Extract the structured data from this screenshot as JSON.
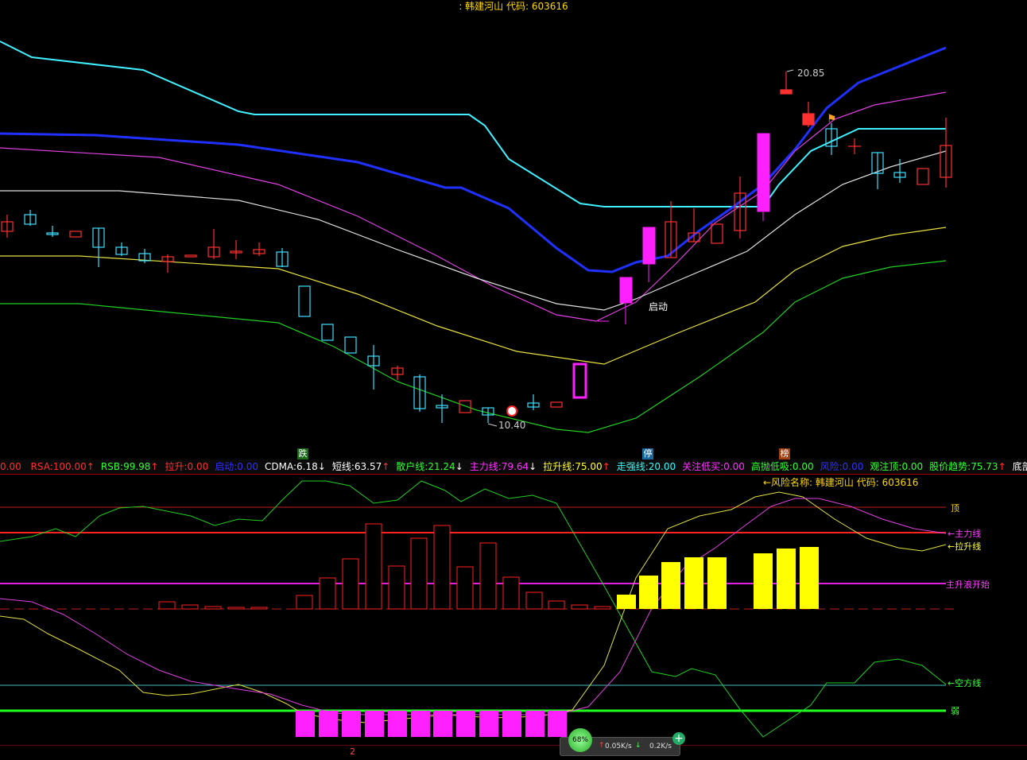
{
  "header": {
    "title": ": 韩建河山  代码: 603616"
  },
  "annotations": {
    "high_price": "20.85",
    "low_price": "10.40",
    "start_label": "启动"
  },
  "markers": {
    "die": "跌",
    "ting": "停",
    "bang": "榜"
  },
  "indicators": [
    {
      "label": "RSA:",
      "value": "100.00",
      "arrow": "↑",
      "color": "#ff3030"
    },
    {
      "label": "RSB:",
      "value": "99.98",
      "arrow": "↑",
      "color": "#30ff30"
    },
    {
      "label": "拉升:",
      "value": "0.00",
      "arrow": "",
      "color": "#ff3030"
    },
    {
      "label": "启动:",
      "value": "0.00",
      "arrow": "",
      "color": "#3030ff"
    },
    {
      "label": "CDMA:",
      "value": "6.18",
      "arrow": "↓",
      "color": "#ffffff"
    },
    {
      "label": "短线:",
      "value": "63.57",
      "arrow": "↑",
      "color": "#ffffff"
    },
    {
      "label": "散户线:",
      "value": "21.24",
      "arrow": "↓",
      "color": "#30ff30"
    },
    {
      "label": "主力线:",
      "value": "79.64",
      "arrow": "↓",
      "color": "#ff30ff"
    },
    {
      "label": "拉升线:",
      "value": "75.00",
      "arrow": "↑",
      "color": "#ffff30"
    },
    {
      "label": "走强线:",
      "value": "20.00",
      "arrow": "",
      "color": "#30ffff"
    },
    {
      "label": "关注低买:",
      "value": "0.00",
      "arrow": "",
      "color": "#ff30ff"
    },
    {
      "label": "高抛低吸:",
      "value": "0.00",
      "arrow": "",
      "color": "#30ff30"
    },
    {
      "label": "风险:",
      "value": "0.00",
      "arrow": "",
      "color": "#3030ff"
    },
    {
      "label": "观注顶:",
      "value": "0.00",
      "arrow": "",
      "color": "#30ff30"
    },
    {
      "label": "股价趋势:",
      "value": "75.73",
      "arrow": "↑",
      "color": "#30ff30"
    },
    {
      "label": "底部警戒",
      "value": "",
      "arrow": "",
      "color": "#ffffff"
    }
  ],
  "indicator_prefix": "0.00",
  "sub_panel": {
    "title": "←风险名称: 韩建河山  代码: 603616",
    "labels": {
      "top": "顶",
      "main_line": "←主力线",
      "lift_line": "←拉升线",
      "rise_start": "主升浪开始",
      "short_line": "←空方线",
      "weak": "弱"
    }
  },
  "status": {
    "page": "2",
    "net_percent": "68%",
    "up_speed": "0.05K/s",
    "down_speed": "0.2K/s"
  },
  "colors": {
    "bull": "#ff3030",
    "bear": "#40e0ff",
    "magenta": "#ff20ff",
    "yellow": "#ffff00",
    "green": "#20d020"
  }
}
